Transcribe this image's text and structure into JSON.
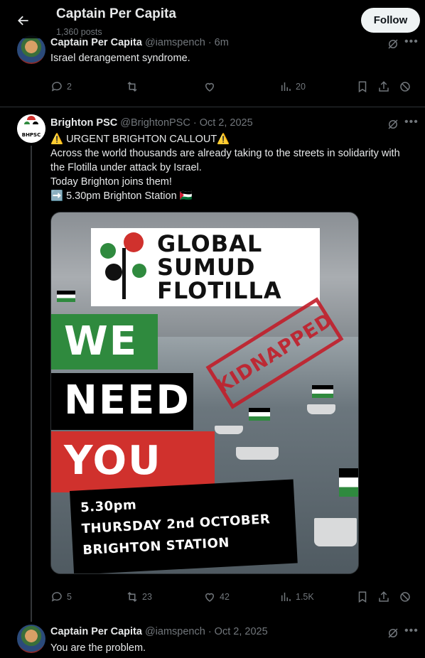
{
  "header": {
    "back_icon": "arrow-left-icon",
    "title": "Captain Per Capita",
    "post_count": "1,360 posts",
    "follow_label": "Follow"
  },
  "tweets": [
    {
      "author": "Captain Per Capita",
      "handle": "@iamspench",
      "time": "· 6m",
      "text": "Israel derangement syndrome.",
      "replies": "2",
      "reposts": "",
      "likes": "",
      "views": "20"
    },
    {
      "author": "Brighton PSC",
      "handle": "@BrightonPSC",
      "time": "· Oct 2, 2025",
      "avatar_text": "BHPSC",
      "lines": [
        "⚠️ URGENT BRIGHTON CALLOUT⚠️",
        "Across the world thousands are already taking to the streets in solidarity with the Flotilla under attack by Israel.",
        "Today Brighton joins them!",
        "➡️ 5.30pm Brighton Station 🇵🇸"
      ],
      "replies": "5",
      "reposts": "23",
      "likes": "42",
      "views": "1.5K",
      "media": {
        "logo_line1": "GLOBAL",
        "logo_line2": "SUMUD",
        "logo_line3": "FLOTILLA",
        "word1": "WE",
        "word2": "NEED",
        "word3": "YOU",
        "stamp": "KIDNAPPED",
        "info1": "5.30pm",
        "info2": "THURSDAY 2nd OCTOBER",
        "info3": "BRIGHTON STATION"
      }
    },
    {
      "author": "Captain Per Capita",
      "handle": "@iamspench",
      "time": "· Oct 2, 2025",
      "text": "You are the problem."
    }
  ],
  "colors": {
    "background": "#000000",
    "muted": "#71767b",
    "follow_bg": "#eff3f4",
    "palestine_green": "#2f8a3e",
    "palestine_red": "#d0312d"
  }
}
